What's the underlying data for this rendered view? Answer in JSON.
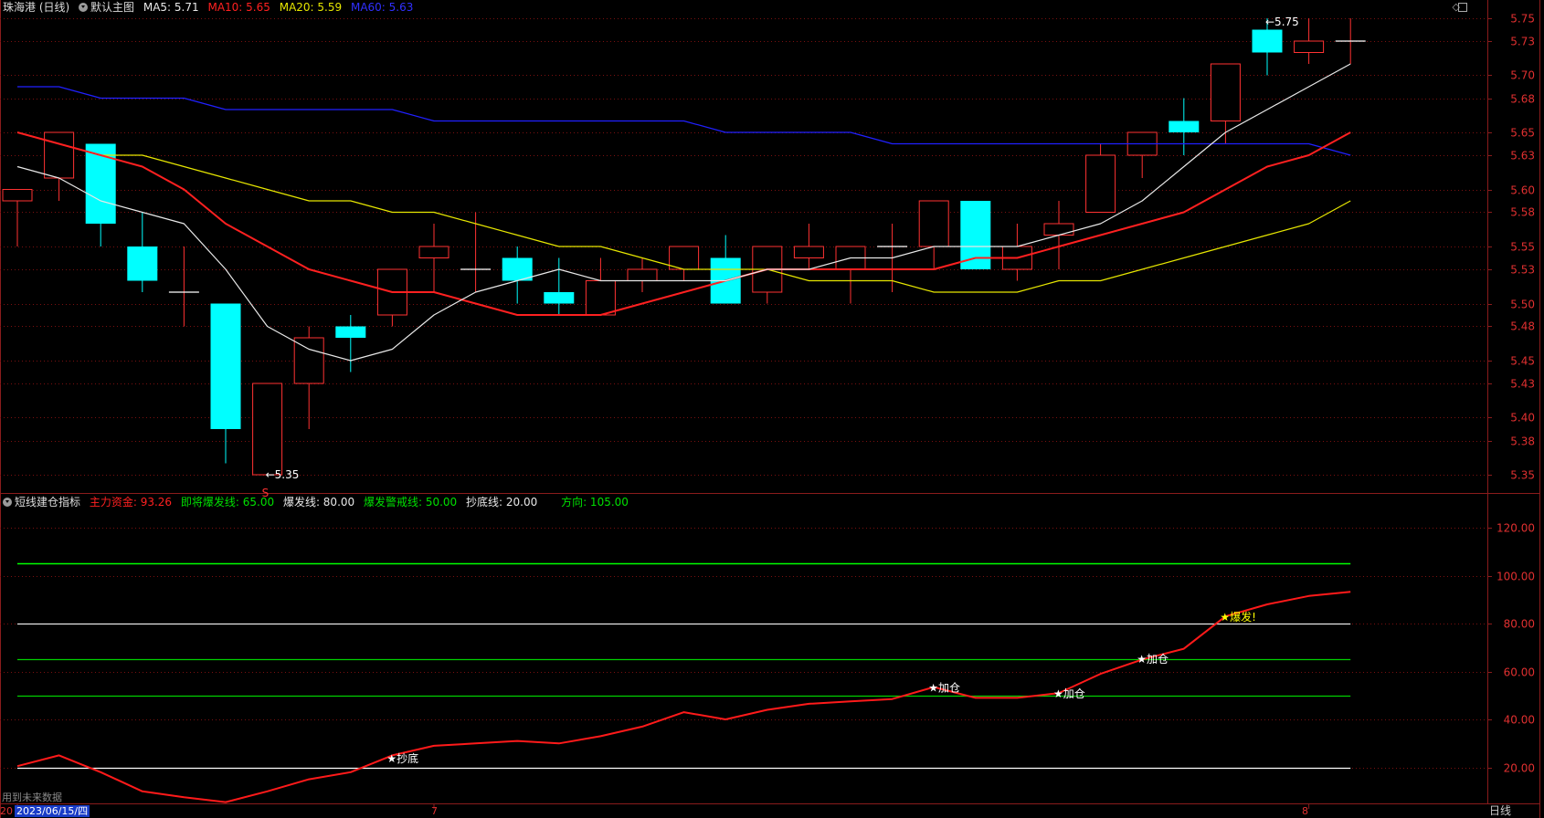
{
  "header": {
    "stock": "珠海港 (日线)",
    "main_chart": "默认主图",
    "ma5": "MA5: 5.71",
    "ma10": "MA10: 5.65",
    "ma20": "MA20: 5.59",
    "ma60": "MA60: 5.63"
  },
  "indicator_header": {
    "name": "短线建仓指标",
    "main_funds": "主力资金: 93.26",
    "near_burst": "即将爆发线: 65.00",
    "burst": "爆发线: 80.00",
    "burst_warning": "爆发警戒线: 50.00",
    "bottom": "抄底线: 20.00",
    "direction": "方向: 105.00"
  },
  "colors": {
    "up": "#ff3232",
    "down": "#00ffff",
    "ma5": "#e8e8e8",
    "ma10": "#ff2020",
    "ma20": "#e6e600",
    "ma60": "#2020ff",
    "axis": "#8a1c1c"
  },
  "footer": {
    "note": "用到未来数据",
    "date_prefix": "20",
    "date": "2023/06/15/四",
    "month_7": "7",
    "month_8": "8",
    "period": "日线"
  },
  "chart_data": [
    {
      "type": "candlestick",
      "price_axis": {
        "ylim": [
          5.33,
          5.76
        ],
        "ticks": [
          5.75,
          5.73,
          5.7,
          5.68,
          5.65,
          5.63,
          5.6,
          5.58,
          5.55,
          5.53,
          5.5,
          5.48,
          5.45,
          5.43,
          5.4,
          5.38,
          5.35
        ]
      },
      "candles": [
        {
          "o": 5.59,
          "h": 5.6,
          "l": 5.55,
          "c": 5.6
        },
        {
          "o": 5.61,
          "h": 5.65,
          "l": 5.59,
          "c": 5.65
        },
        {
          "o": 5.64,
          "h": 5.64,
          "l": 5.55,
          "c": 5.57
        },
        {
          "o": 5.55,
          "h": 5.58,
          "l": 5.51,
          "c": 5.52
        },
        {
          "o": 5.51,
          "h": 5.55,
          "l": 5.48,
          "c": 5.51
        },
        {
          "o": 5.5,
          "h": 5.5,
          "l": 5.36,
          "c": 5.39
        },
        {
          "o": 5.35,
          "h": 5.43,
          "l": 5.35,
          "c": 5.43
        },
        {
          "o": 5.43,
          "h": 5.48,
          "l": 5.39,
          "c": 5.47
        },
        {
          "o": 5.48,
          "h": 5.49,
          "l": 5.44,
          "c": 5.47
        },
        {
          "o": 5.49,
          "h": 5.53,
          "l": 5.48,
          "c": 5.53
        },
        {
          "o": 5.54,
          "h": 5.57,
          "l": 5.51,
          "c": 5.55
        },
        {
          "o": 5.53,
          "h": 5.58,
          "l": 5.51,
          "c": 5.53
        },
        {
          "o": 5.54,
          "h": 5.55,
          "l": 5.5,
          "c": 5.52
        },
        {
          "o": 5.51,
          "h": 5.54,
          "l": 5.49,
          "c": 5.5
        },
        {
          "o": 5.49,
          "h": 5.54,
          "l": 5.49,
          "c": 5.52
        },
        {
          "o": 5.52,
          "h": 5.54,
          "l": 5.51,
          "c": 5.53
        },
        {
          "o": 5.53,
          "h": 5.55,
          "l": 5.52,
          "c": 5.55
        },
        {
          "o": 5.54,
          "h": 5.56,
          "l": 5.5,
          "c": 5.5
        },
        {
          "o": 5.51,
          "h": 5.55,
          "l": 5.5,
          "c": 5.55
        },
        {
          "o": 5.54,
          "h": 5.57,
          "l": 5.53,
          "c": 5.55
        },
        {
          "o": 5.53,
          "h": 5.55,
          "l": 5.5,
          "c": 5.55
        },
        {
          "o": 5.55,
          "h": 5.57,
          "l": 5.51,
          "c": 5.55
        },
        {
          "o": 5.55,
          "h": 5.59,
          "l": 5.53,
          "c": 5.59
        },
        {
          "o": 5.59,
          "h": 5.59,
          "l": 5.53,
          "c": 5.53
        },
        {
          "o": 5.53,
          "h": 5.57,
          "l": 5.52,
          "c": 5.55
        },
        {
          "o": 5.56,
          "h": 5.59,
          "l": 5.53,
          "c": 5.57
        },
        {
          "o": 5.58,
          "h": 5.64,
          "l": 5.58,
          "c": 5.63
        },
        {
          "o": 5.63,
          "h": 5.65,
          "l": 5.61,
          "c": 5.65
        },
        {
          "o": 5.66,
          "h": 5.68,
          "l": 5.63,
          "c": 5.65
        },
        {
          "o": 5.66,
          "h": 5.71,
          "l": 5.64,
          "c": 5.71
        },
        {
          "o": 5.74,
          "h": 5.75,
          "l": 5.7,
          "c": 5.72
        },
        {
          "o": 5.72,
          "h": 5.75,
          "l": 5.71,
          "c": 5.73
        },
        {
          "o": 5.73,
          "h": 5.75,
          "l": 5.71,
          "c": 5.73
        }
      ],
      "ma5": [
        5.62,
        5.61,
        5.59,
        5.58,
        5.57,
        5.53,
        5.48,
        5.46,
        5.45,
        5.46,
        5.49,
        5.51,
        5.52,
        5.53,
        5.52,
        5.52,
        5.52,
        5.52,
        5.53,
        5.53,
        5.54,
        5.54,
        5.55,
        5.55,
        5.55,
        5.56,
        5.57,
        5.59,
        5.62,
        5.65,
        5.67,
        5.69,
        5.71
      ],
      "ma10": [
        5.65,
        5.64,
        5.63,
        5.62,
        5.6,
        5.57,
        5.55,
        5.53,
        5.52,
        5.51,
        5.51,
        5.5,
        5.49,
        5.49,
        5.49,
        5.5,
        5.51,
        5.52,
        5.53,
        5.53,
        5.53,
        5.53,
        5.53,
        5.54,
        5.54,
        5.55,
        5.56,
        5.57,
        5.58,
        5.6,
        5.62,
        5.63,
        5.65
      ],
      "ma20": [
        5.65,
        5.64,
        5.63,
        5.63,
        5.62,
        5.61,
        5.6,
        5.59,
        5.59,
        5.58,
        5.58,
        5.57,
        5.56,
        5.55,
        5.55,
        5.54,
        5.53,
        5.53,
        5.53,
        5.52,
        5.52,
        5.52,
        5.51,
        5.51,
        5.51,
        5.52,
        5.52,
        5.53,
        5.54,
        5.55,
        5.56,
        5.57,
        5.59
      ],
      "ma60": [
        5.69,
        5.69,
        5.68,
        5.68,
        5.68,
        5.67,
        5.67,
        5.67,
        5.67,
        5.67,
        5.66,
        5.66,
        5.66,
        5.66,
        5.66,
        5.66,
        5.66,
        5.65,
        5.65,
        5.65,
        5.65,
        5.64,
        5.64,
        5.64,
        5.64,
        5.64,
        5.64,
        5.64,
        5.64,
        5.64,
        5.64,
        5.64,
        5.63
      ],
      "annotations": [
        {
          "index": 6,
          "price": 5.35,
          "text": "←5.35",
          "color": "#ffffff"
        },
        {
          "index": 6,
          "price": 5.342,
          "text": "S",
          "color": "#ff3232"
        },
        {
          "index": 30,
          "price": 5.747,
          "text": "←5.75",
          "color": "#ffffff"
        }
      ]
    },
    {
      "type": "line",
      "value_axis": {
        "ylim": [
          13,
          135
        ],
        "ticks": [
          120,
          100,
          80,
          60,
          40,
          20
        ]
      },
      "main_funds": [
        20.5,
        25,
        18,
        10,
        7.5,
        5.5,
        10,
        15,
        18,
        25,
        29,
        30,
        31,
        30,
        33,
        37,
        43,
        40,
        44,
        46.5,
        47.5,
        48.5,
        53.5,
        49,
        49,
        51,
        59,
        65,
        69.5,
        83,
        88,
        91.5,
        93.26
      ],
      "reference_lines": [
        {
          "value": 105,
          "color": "#00ff00"
        },
        {
          "value": 80,
          "color": "#e8e8e8"
        },
        {
          "value": 65,
          "color": "#00d000"
        },
        {
          "value": 50,
          "color": "#00d000"
        },
        {
          "value": 20,
          "color": "#ffffff"
        }
      ],
      "signals": [
        {
          "index": 9,
          "value": 24,
          "text": "★抄底",
          "color": "#ffffff"
        },
        {
          "index": 22,
          "value": 53.5,
          "text": "★加仓",
          "color": "#ffffff"
        },
        {
          "index": 25,
          "value": 51,
          "text": "★加仓",
          "color": "#ffffff"
        },
        {
          "index": 27,
          "value": 65.5,
          "text": "★加仓",
          "color": "#ffffff"
        },
        {
          "index": 29,
          "value": 83,
          "text": "★爆发!",
          "color": "#ffff00"
        }
      ]
    }
  ]
}
